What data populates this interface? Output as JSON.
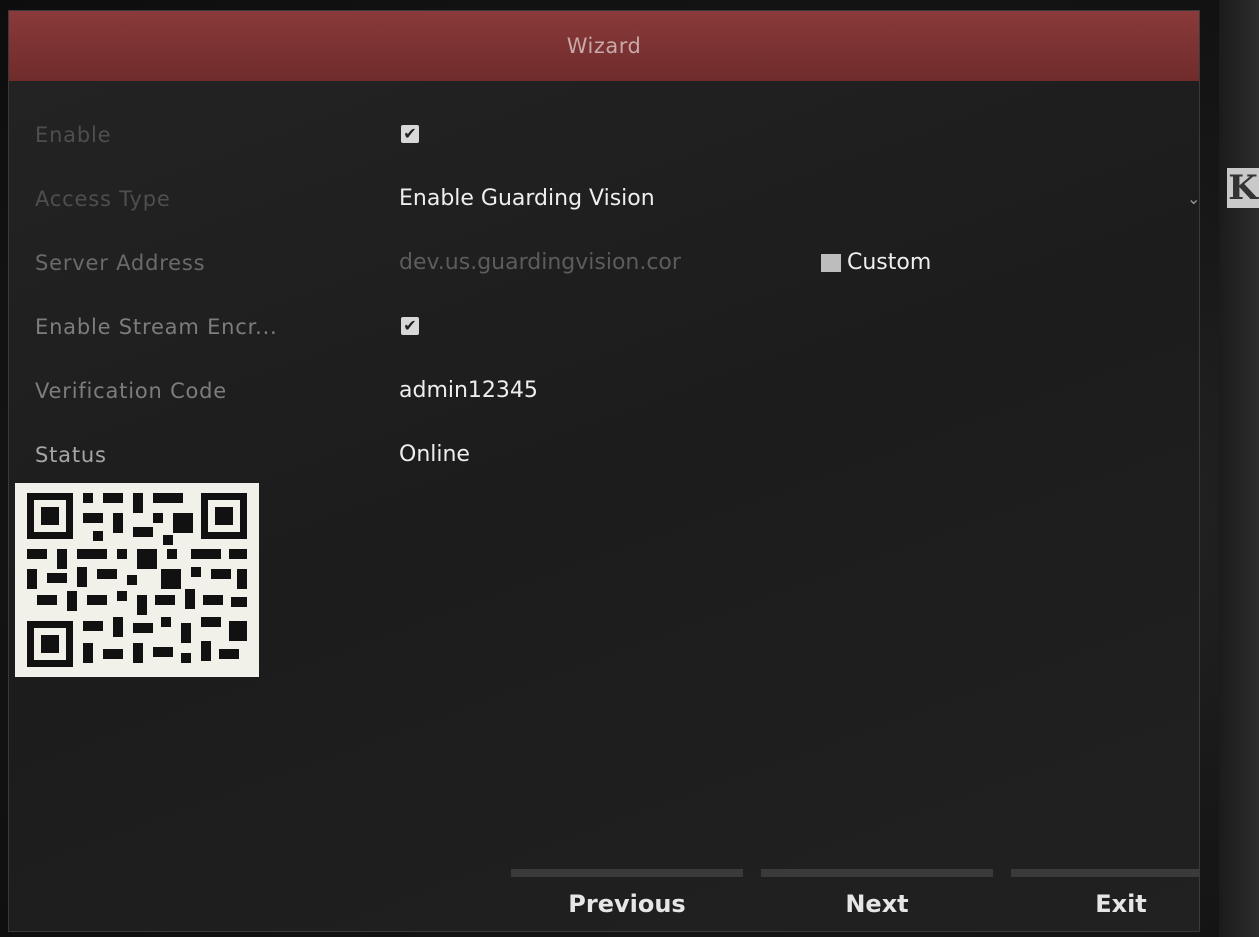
{
  "window": {
    "title": "Wizard"
  },
  "form": {
    "enable": {
      "label": "Enable",
      "checkbox_glyph": "✔"
    },
    "access_type": {
      "label": "Access Type",
      "value": "Enable Guarding Vision",
      "dropdown_glyph": "⌄"
    },
    "server_address": {
      "label": "Server Address",
      "value": "dev.us.guardingvision.cor",
      "custom_label": "Custom"
    },
    "stream_encryption": {
      "label": "Enable Stream Encr...",
      "checkbox_glyph": "✔"
    },
    "verification_code": {
      "label": "Verification Code",
      "value": "admin12345"
    },
    "status": {
      "label": "Status",
      "value": "Online"
    }
  },
  "footer": {
    "previous_label": "Previous",
    "next_label": "Next",
    "exit_label": "Exit"
  },
  "background": {
    "side_letter": "K"
  },
  "colors": {
    "title_bar": "#7a3030",
    "panel": "#1f1f1f",
    "text_primary": "#eeeeee",
    "text_label": "#7d7d7d"
  }
}
